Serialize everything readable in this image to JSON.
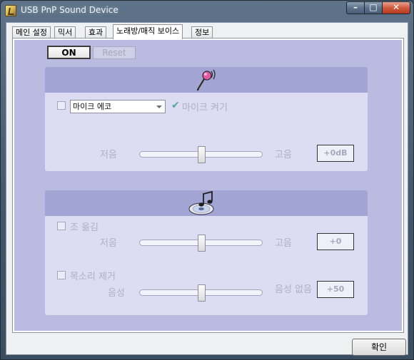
{
  "window": {
    "title": "USB PnP Sound Device",
    "controls": {
      "minimize": "–",
      "maximize": "□",
      "close": "✕"
    }
  },
  "tabs": [
    {
      "label": "메인 설정",
      "active": false
    },
    {
      "label": "믹서",
      "active": false
    },
    {
      "label": "효과",
      "active": false
    },
    {
      "label": "노래방/매직 보이스",
      "active": true
    },
    {
      "label": "정보",
      "active": false
    }
  ],
  "toolbar": {
    "on_label": "ON",
    "reset_label": "Reset"
  },
  "karaoke": {
    "icon": "microphone-icon",
    "mic_echo_select": {
      "value": "마이크 에코"
    },
    "mic_on_label": "마이크 켜기",
    "low_label": "저음",
    "high_label": "고음",
    "value": "+0dB",
    "slider_level": 0.5
  },
  "magic_voice": {
    "icon": "music-disc-icon",
    "key_shift_label": "조 옮김",
    "key_low_label": "저음",
    "key_high_label": "고음",
    "key_value": "+0",
    "key_slider_level": 0.5,
    "vocal_remove_label": "목소리 제거",
    "vocal_low_label": "음성",
    "vocal_high_label": "음성 없음",
    "vocal_value": "+50",
    "vocal_slider_level": 0.5
  },
  "footer": {
    "ok_label": "확인"
  },
  "colors": {
    "panel_bg": "#babbe0",
    "section_head": "#a2a5d3",
    "section_body": "#dcdcf2",
    "check_mark": "#55a7a0"
  }
}
